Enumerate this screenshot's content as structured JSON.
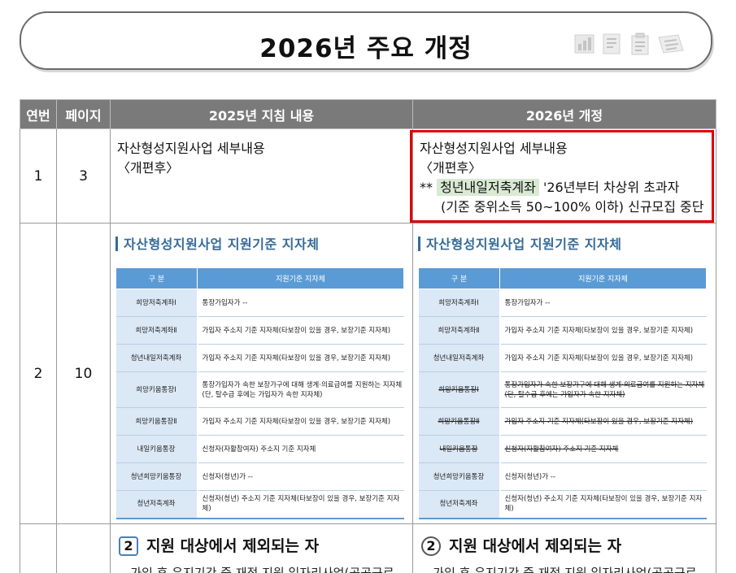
{
  "header": {
    "title": "2026년 주요 개정"
  },
  "table": {
    "columns": [
      "연번",
      "페이지",
      "2025년 지침 내용",
      "2026년 개정"
    ],
    "row1": {
      "no": "1",
      "page": "3",
      "old_line1": "자산형성지원사업 세부내용",
      "old_line2": "〈개편후〉",
      "new_line1": "자산형성지원사업 세부내용",
      "new_line2": "〈개편후〉",
      "new_note_prefix": "**",
      "new_note_highlight": "청년내일저축계좌",
      "new_note_rest": "'26년부터 차상위 초과자",
      "new_note_line2": "(기준 중위소득 50~100% 이하) 신규모집 중단"
    },
    "row2": {
      "no": "2",
      "page": "10",
      "old_subheading": "자산형성지원사업 지원기준 지자체",
      "new_subheading": "자산형성지원사업 지원기준 지자체",
      "inner_headers": [
        "구 분",
        "지원기준 지자체"
      ],
      "old_rows": [
        {
          "cat": "희망저축계좌Ⅰ",
          "desc": "통장가입자가 --"
        },
        {
          "cat": "희망저축계좌Ⅱ",
          "desc": "가입자 주소지 기준 지자체(타보장이 있을 경우, 보장기준 지자체)"
        },
        {
          "cat": "청년내일저축계좌",
          "desc": "가입자 주소지 기준 지자체(타보장이 있을 경우, 보장기준 지자체)"
        },
        {
          "cat": "희망키움통장Ⅰ",
          "desc": "통장가입자가 속한 보장가구에 대해 생계·의료급여를 지원하는 지자체 (단, 탈수급 후에는 가입자가 속한 지자체)"
        },
        {
          "cat": "희망키움통장Ⅱ",
          "desc": "가입자 주소지 기준 지자체(타보장이 있을 경우, 보장기준 지자체)"
        },
        {
          "cat": "내일키움통장",
          "desc": "신청자(자활참여자) 주소지 기준 지자체"
        },
        {
          "cat": "청년희망키움통장",
          "desc": "신청자(청년)가 --"
        },
        {
          "cat": "청년저축계좌",
          "desc": "신청자(청년) 주소지 기준 지자체(타보장이 있을 경우, 보장기준 지자체)"
        }
      ],
      "new_rows": [
        {
          "cat": "희망저축계좌Ⅰ",
          "desc": "통장가입자가 --"
        },
        {
          "cat": "희망저축계좌Ⅱ",
          "desc": "가입자 주소지 기준 지자체(타보장이 있을 경우, 보장기준 지자체)"
        },
        {
          "cat": "청년내일저축계좌",
          "desc": "가입자 주소지 기준 지자체(타보장이 있을 경우, 보장기준 지자체)"
        },
        {
          "cat": "희망키움통장Ⅰ",
          "desc": "통장가입자가 속한 보장가구에 대해 생계·의료급여를 지원하는 지자체 (단, 탈수급 후에는 가입자가 속한 지자체)"
        },
        {
          "cat": "희망키움통장Ⅱ",
          "desc": "가입자 주소지 기준 지자체(타보장이 있을 경우, 보장기준 지자체)"
        },
        {
          "cat": "내일키움통장",
          "desc": "신청자(자활참여자) 주소지 기준 지자체"
        },
        {
          "cat": "청년희망키움통장",
          "desc": "신청자(청년)가 --"
        },
        {
          "cat": "청년저축계좌",
          "desc": "신청자(청년) 주소지 기준 지자체(타보장이 있을 경우, 보장기준 지자체)"
        }
      ]
    },
    "row3": {
      "old_num": "2",
      "old_heading": "지원 대상에서 제외되는 자",
      "old_sub": "– 가입 후 유지기간 중 재정 지원 일자리사업(공공근로",
      "new_num": "2",
      "new_heading": "지원 대상에서 제외되는 자",
      "new_sub": "– 가입 후 유지기간 중 재정 지원 일자리사업(공공근로"
    }
  },
  "colors": {
    "header_bg": "#7a7a7a",
    "highlight": "#d9ead3",
    "red_box": "#e00000",
    "inner_header": "#5b9bd5",
    "inner_cat": "#dbe8f5",
    "subheading": "#356b9a"
  },
  "icons": [
    "bar-chart-icon",
    "document-icon",
    "clipboard-icon",
    "list-document-icon"
  ]
}
